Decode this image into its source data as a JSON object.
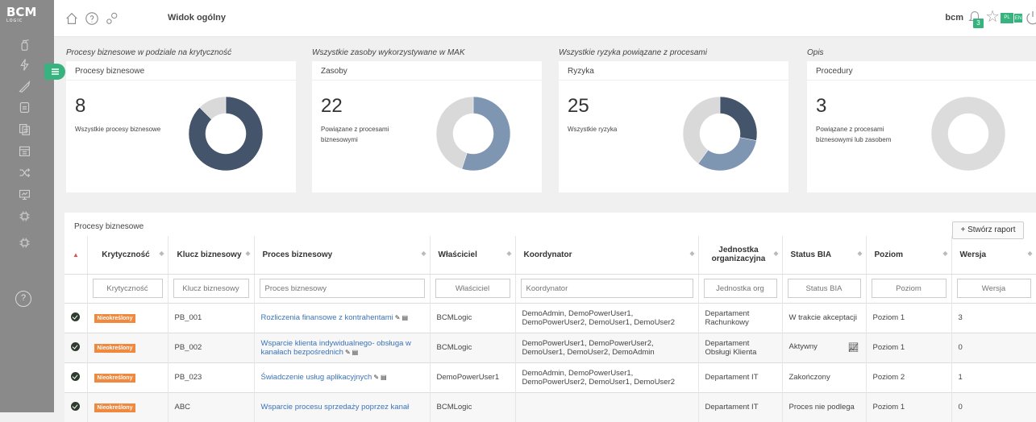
{
  "app": {
    "logo": "BCM",
    "logo_sub": "LOGIC"
  },
  "header": {
    "page_title": "Widok ogólny",
    "user": "bcm",
    "notif_count": "3",
    "lang_pl": "PL",
    "lang_en": "EN"
  },
  "sections": {
    "processes_label": "Procesy biznesowe w podziale na krytyczność",
    "assets_label": "Wszystkie zasoby wykorzystywane w MAK",
    "risks_label": "Wszystkie ryzyka powiązane z procesami",
    "desc_label": "Opis"
  },
  "cards": [
    {
      "title": "Procesy biznesowe",
      "value": "8",
      "desc": "Wszystkie procesy biznesowe"
    },
    {
      "title": "Zasoby",
      "value": "22",
      "desc": "Powiązane z procesami biznesowymi"
    },
    {
      "title": "Ryzyka",
      "value": "25",
      "desc": "Wszystkie ryzyka"
    },
    {
      "title": "Procedury",
      "value": "3",
      "desc": "Powiązane z procesami biznesowymi lub zasobem"
    }
  ],
  "donuts": [
    {
      "segments": [
        {
          "fraction": 0.875,
          "color": "#44546a"
        },
        {
          "fraction": 0.125,
          "color": "#d9d9d9"
        }
      ]
    },
    {
      "segments": [
        {
          "fraction": 0.55,
          "color": "#7f96b2"
        },
        {
          "fraction": 0.45,
          "color": "#d9d9d9"
        }
      ]
    },
    {
      "segments": [
        {
          "fraction": 0.28,
          "color": "#44546a"
        },
        {
          "fraction": 0.32,
          "color": "#7f96b2"
        },
        {
          "fraction": 0.4,
          "color": "#d9d9d9"
        }
      ]
    },
    {
      "segments": [
        {
          "fraction": 1.0,
          "color": "#dcdcdc"
        }
      ]
    }
  ],
  "table": {
    "title": "Procesy biznesowe",
    "create_report": "+ Stwórz raport",
    "columns": [
      "Krytyczność",
      "Klucz biznesowy",
      "Proces biznesowy",
      "Właściciel",
      "Koordynator",
      "Jednostka organizacyjna",
      "Status BIA",
      "Poziom",
      "Wersja"
    ],
    "filters": [
      "Krytyczność",
      "Klucz biznesowy",
      "Proces biznesowy",
      "Właściciel",
      "Koordynator",
      "Jednostka org",
      "Status BIA",
      "Poziom",
      "Wersja"
    ],
    "rows": [
      {
        "criticality": "Nieokreślony",
        "key": "PB_001",
        "process": "Rozliczenia finansowe z kontrahentami",
        "owner": "BCMLogic",
        "coordinator": "DemoAdmin, DemoPowerUser1, DemoPowerUser2, DemoUser1, DemoUser2",
        "unit": "Departament Rachunkowy",
        "status": "W trakcie akceptacji",
        "level": "Poziom 1",
        "version": "3"
      },
      {
        "criticality": "Nieokreślony",
        "key": "PB_002",
        "process": "Wsparcie klienta indywidualnego- obsługa w kanałach bezpośrednich",
        "owner": "BCMLogic",
        "coordinator": "DemoPowerUser1, DemoPowerUser2, DemoUser1, DemoUser2, DemoAdmin",
        "unit": "Departament Obsługi Klienta",
        "status": "Aktywny",
        "level": "Poziom 1",
        "version": "0"
      },
      {
        "criticality": "Nieokreślony",
        "key": "PB_023",
        "process": "Świadczenie usług aplikacyjnych",
        "owner": "DemoPowerUser1",
        "coordinator": "DemoAdmin, DemoPowerUser1, DemoPowerUser2, DemoUser1, DemoUser2",
        "unit": "Departament IT",
        "status": "Zakończony",
        "level": "Poziom 2",
        "version": "1"
      },
      {
        "criticality": "Nieokreślony",
        "key": "ABC",
        "process": "Wsparcie procesu sprzedaży poprzez kanał",
        "owner": "BCMLogic",
        "coordinator": "",
        "unit": "Departament IT",
        "status": "Proces nie podlega",
        "level": "Poziom 1",
        "version": "0"
      }
    ]
  }
}
